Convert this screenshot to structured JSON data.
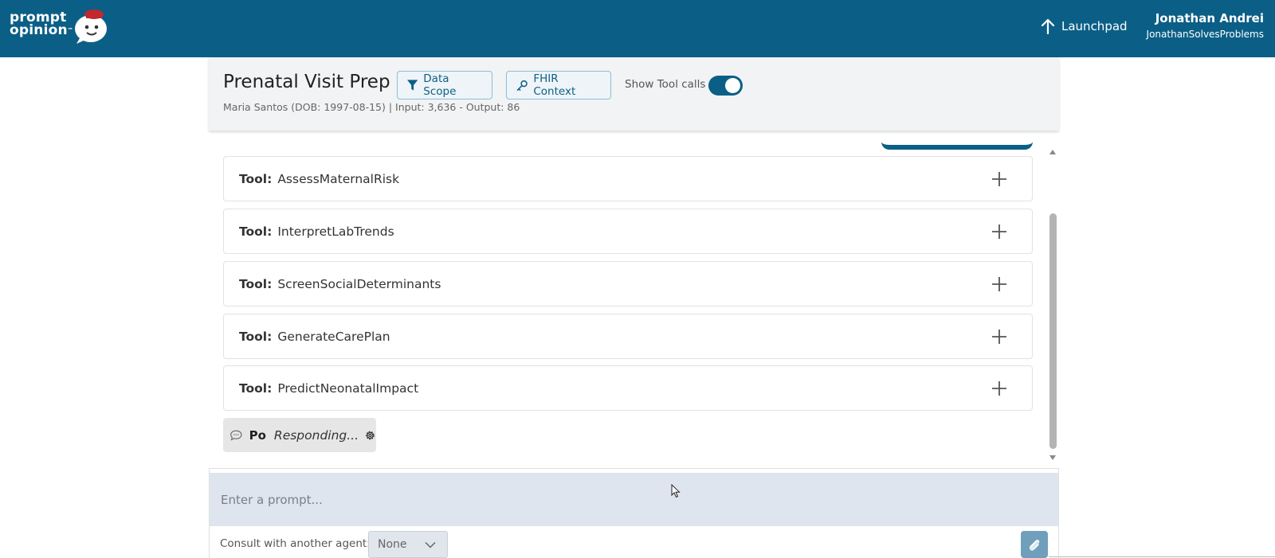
{
  "app": {
    "logo_line1": "prompt",
    "logo_line2": "opinion",
    "logo_tm": "™"
  },
  "topbar": {
    "launchpad_label": "Launchpad",
    "user_name": "Jonathan Andrei",
    "user_handle": "JonathanSolvesProblems"
  },
  "header": {
    "title": "Prenatal Visit Prep",
    "subtitle": "Maria Santos (DOB: 1997-08-15)  | Input: 3,636 - Output: 86",
    "data_scope_label": "Data Scope",
    "fhir_context_label": "FHIR Context",
    "show_tool_calls_label": "Show Tool calls",
    "show_tool_calls_on": true
  },
  "tools": [
    {
      "label": "Tool:",
      "name": "AssessMaternalRisk"
    },
    {
      "label": "Tool:",
      "name": "InterpretLabTrends"
    },
    {
      "label": "Tool:",
      "name": "ScreenSocialDeterminants"
    },
    {
      "label": "Tool:",
      "name": "GenerateCarePlan"
    },
    {
      "label": "Tool:",
      "name": "PredictNeonatalImpact"
    }
  ],
  "status": {
    "agent": "Po",
    "text": "Responding..."
  },
  "prompt": {
    "placeholder": "Enter a prompt...",
    "consult_label": "Consult with another agent:",
    "consult_value": "None"
  },
  "colors": {
    "brand": "#0b5f86",
    "input_bg": "#dee5ee"
  },
  "icons": [
    "arrow-up-icon",
    "filter-icon",
    "key-icon",
    "plus-icon",
    "chat-bubble-icon",
    "gear-icon",
    "chevron-down-icon",
    "paperclip-icon"
  ]
}
